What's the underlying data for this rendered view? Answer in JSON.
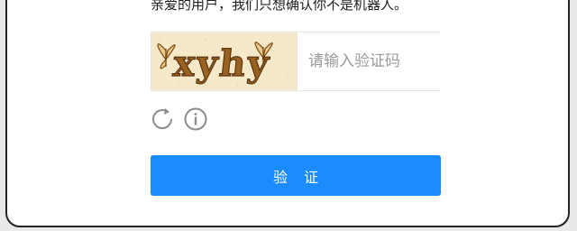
{
  "prompt_text": "亲爱的用户，我们只想确认你不是机器人。",
  "captcha": {
    "image_text": "xyhy",
    "input_placeholder": "请输入验证码",
    "input_value": ""
  },
  "controls": {
    "refresh_icon": "refresh-icon",
    "info_icon": "info-icon"
  },
  "verify_button_label": "验证",
  "colors": {
    "accent": "#1a8cff",
    "captcha_background": "#f6e9c9",
    "captcha_text": "#8b5a1a"
  }
}
